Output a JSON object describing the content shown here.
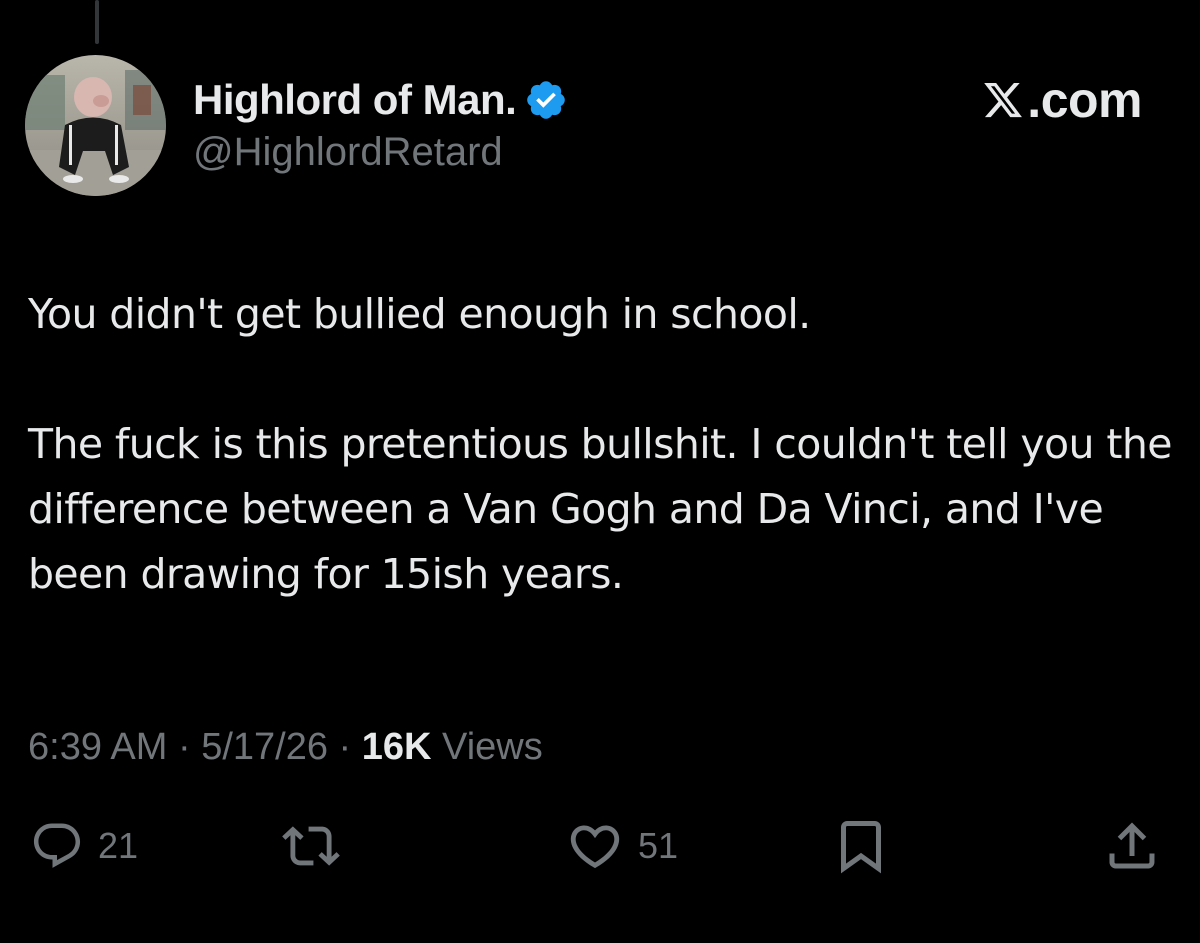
{
  "author": {
    "display_name": "Highlord of Man.",
    "handle": "@HighlordRetard",
    "verified": true,
    "verified_color": "#1d9bf0",
    "avatar_icon": "avatar-photo"
  },
  "brand": {
    "label": ".com",
    "icon": "x-logo-icon"
  },
  "tweet": {
    "paragraphs": [
      "You didn't get bullied enough in school.",
      "The fuck is this pretentious bullshit. I couldn't tell you the difference between a Van Gogh and Da Vinci, and I've been drawing for 15ish years."
    ]
  },
  "meta": {
    "time": "6:39 AM",
    "separator": " · ",
    "date": "5/17/26",
    "views_count": "16K",
    "views_label": " Views"
  },
  "actions": {
    "reply": {
      "icon": "reply-icon",
      "count": "21"
    },
    "repost": {
      "icon": "repost-icon",
      "count": ""
    },
    "like": {
      "icon": "heart-icon",
      "count": "51"
    },
    "bookmark": {
      "icon": "bookmark-icon"
    },
    "share": {
      "icon": "share-icon"
    }
  },
  "colors": {
    "background": "#000000",
    "text_primary": "#e7e9ea",
    "text_secondary": "#71767b",
    "accent": "#1d9bf0"
  }
}
